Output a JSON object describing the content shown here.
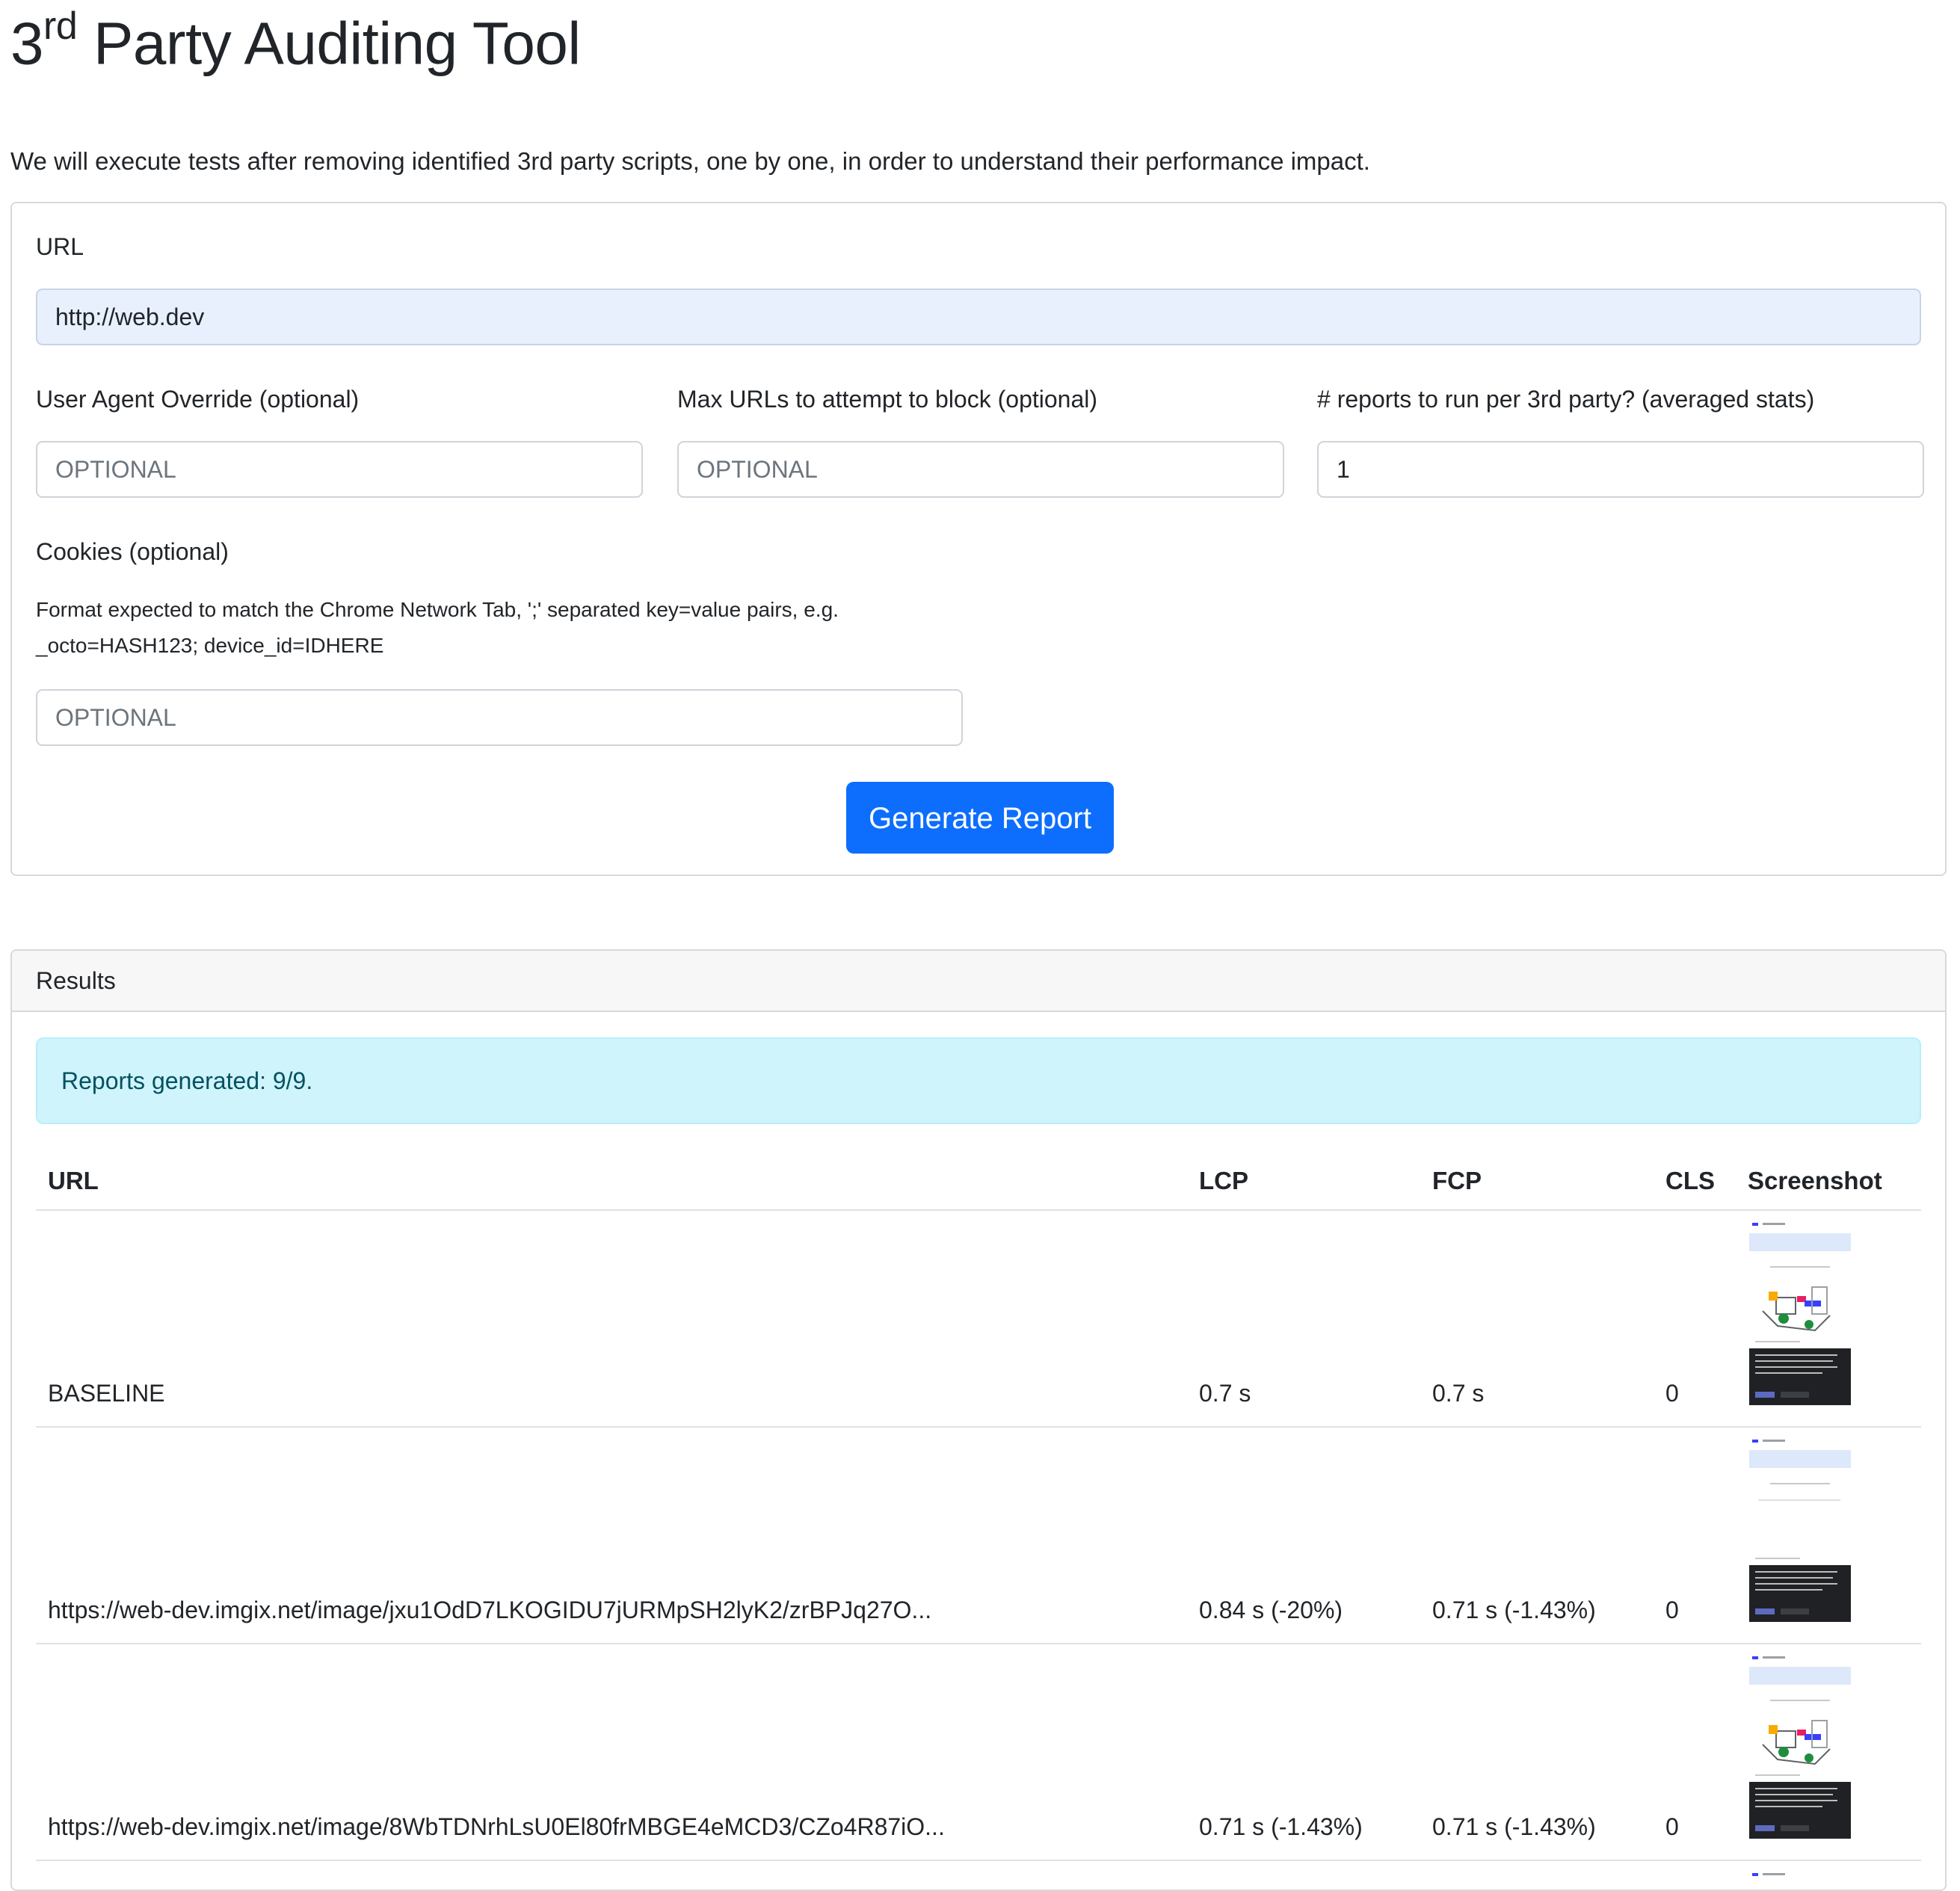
{
  "header": {
    "title_ordinal": "3",
    "title_sup": "rd",
    "title_rest": " Party Auditing Tool",
    "lead": "We will execute tests after removing identified 3rd party scripts, one by one, in order to understand their performance impact."
  },
  "form": {
    "url_label": "URL",
    "url_value": "http://web.dev",
    "ua_label": "User Agent Override (optional)",
    "ua_placeholder": "OPTIONAL",
    "max_label": "Max URLs to attempt to block (optional)",
    "max_placeholder": "OPTIONAL",
    "reports_label": "# reports to run per 3rd party? (averaged stats)",
    "reports_value": "1",
    "cookies_label": "Cookies (optional)",
    "cookies_help_1": "Format expected to match the Chrome Network Tab, ';' separated key=value pairs, e.g.",
    "cookies_help_2": "_octo=HASH123; device_id=IDHERE",
    "cookies_placeholder": "OPTIONAL",
    "submit_label": "Generate Report"
  },
  "results": {
    "header": "Results",
    "status": "Reports generated: 9/9.",
    "columns": [
      "URL",
      "LCP",
      "FCP",
      "CLS",
      "Screenshot"
    ],
    "rows": [
      {
        "url": "BASELINE",
        "lcp": "0.7 s",
        "fcp": "0.7 s",
        "cls": "0"
      },
      {
        "url": "https://web-dev.imgix.net/image/jxu1OdD7LKOGIDU7jURMpSH2lyK2/zrBPJq27O...",
        "lcp": "0.84 s (-20%)",
        "fcp": "0.71 s (-1.43%)",
        "cls": "0"
      },
      {
        "url": "https://web-dev.imgix.net/image/8WbTDNrhLsU0El80frMBGE4eMCD3/CZo4R87iO...",
        "lcp": "0.71 s (-1.43%)",
        "fcp": "0.71 s (-1.43%)",
        "cls": "0"
      }
    ]
  },
  "colors": {
    "primary": "#0d6efd",
    "info_bg": "#cff4fc",
    "info_text": "#055160",
    "url_field_bg": "#e8f0fe"
  }
}
